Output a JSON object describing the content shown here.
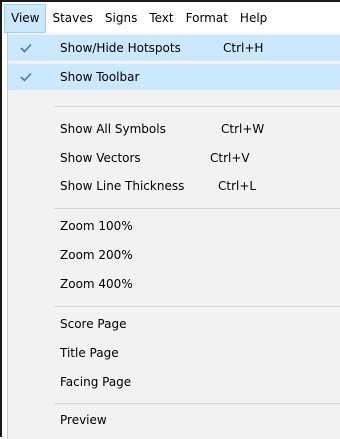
{
  "menubar": {
    "items": [
      "View",
      "Staves",
      "Signs",
      "Text",
      "Format",
      "Help"
    ],
    "active_index": 0
  },
  "colors": {
    "highlight": "#cce8ff",
    "check": "#3e7cc2",
    "menu_background": "#f2f2f2"
  },
  "menu": {
    "items": [
      {
        "label": "Show/Hide Hotspots",
        "shortcut": "Ctrl+H",
        "checked": true
      },
      {
        "label": "Show Toolbar",
        "shortcut": "",
        "checked": true
      },
      {
        "label": "Show All Symbols",
        "shortcut": "Ctrl+W",
        "checked": false
      },
      {
        "label": "Show Vectors",
        "shortcut": "Ctrl+V",
        "checked": false
      },
      {
        "label": "Show Line Thickness",
        "shortcut": "Ctrl+L",
        "checked": false
      },
      {
        "label": "Zoom 100%",
        "shortcut": "",
        "checked": false
      },
      {
        "label": "Zoom 200%",
        "shortcut": "",
        "checked": false
      },
      {
        "label": "Zoom 400%",
        "shortcut": "",
        "checked": false
      },
      {
        "label": "Score Page",
        "shortcut": "",
        "checked": false
      },
      {
        "label": "Title Page",
        "shortcut": "",
        "checked": false
      },
      {
        "label": "Facing Page",
        "shortcut": "",
        "checked": false
      },
      {
        "label": "Preview",
        "shortcut": "",
        "checked": false
      }
    ]
  },
  "check_icon": "checkmark-icon"
}
